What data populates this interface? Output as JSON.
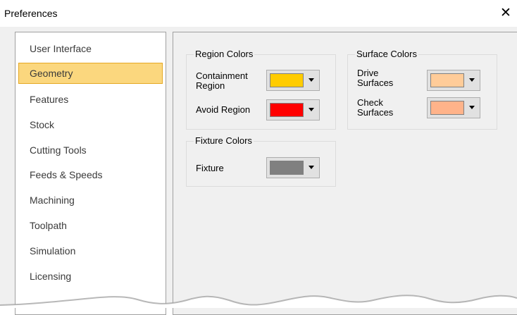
{
  "window": {
    "title": "Preferences",
    "close_glyph": "✕",
    "close_icon": "close-icon"
  },
  "sidebar": {
    "selected_index": 1,
    "items": [
      {
        "label": "User Interface"
      },
      {
        "label": "Geometry"
      },
      {
        "label": "Features"
      },
      {
        "label": "Stock"
      },
      {
        "label": "Cutting Tools"
      },
      {
        "label": "Feeds & Speeds"
      },
      {
        "label": "Machining"
      },
      {
        "label": "Toolpath"
      },
      {
        "label": "Simulation"
      },
      {
        "label": "Licensing"
      }
    ]
  },
  "region_colors": {
    "title": "Region Colors",
    "containment": {
      "label_line1": "Containment",
      "label_line2": "Region",
      "color": "#ffcc00"
    },
    "avoid": {
      "label": "Avoid Region",
      "color": "#ff0000"
    }
  },
  "surface_colors": {
    "title": "Surface Colors",
    "drive": {
      "label_line1": "Drive",
      "label_line2": "Surfaces",
      "color": "#ffcc99"
    },
    "check": {
      "label_line1": "Check",
      "label_line2": "Surfaces",
      "color": "#ffb38a"
    }
  },
  "fixture_colors": {
    "title": "Fixture Colors",
    "fixture": {
      "label": "Fixture",
      "color": "#808080"
    }
  },
  "colors": {
    "selection_bg": "#fbd77e",
    "selection_border": "#e5a823"
  }
}
